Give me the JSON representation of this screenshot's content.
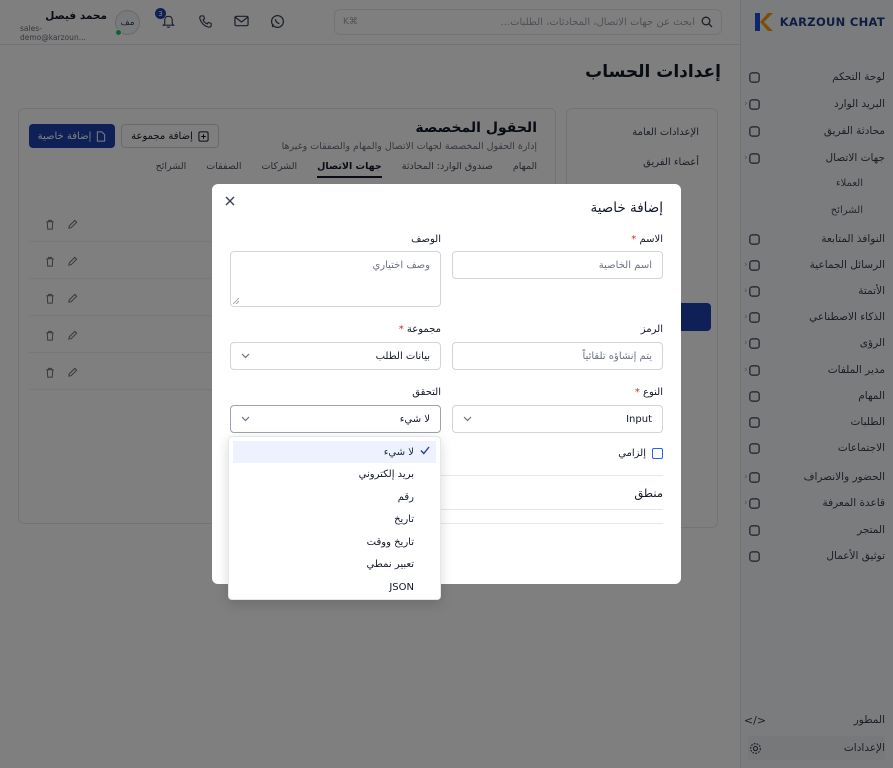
{
  "brand": {
    "name": "KARZOUN CHAT",
    "logo_letter": "K"
  },
  "header": {
    "search_placeholder": "ابحث عن جهات الاتصال، المحادثات، الطلبات...",
    "shortcut": "⌘K",
    "notification_count": "3",
    "user_name": "محمد فيصل",
    "user_email": "sales-demo@karzoun...",
    "avatar_text": "مف"
  },
  "sidebar": {
    "items": [
      {
        "label": "لوحة التحكم",
        "icon": "home-icon"
      },
      {
        "label": "البريد الوارد",
        "icon": "inbox-icon",
        "chevron": true
      },
      {
        "label": "محادثة الفريق",
        "icon": "chat-icon"
      },
      {
        "label": "جهات الاتصال",
        "icon": "users-icon",
        "chevron": true
      },
      {
        "label": "النوافذ المتابعة",
        "icon": "calendar-icon"
      },
      {
        "label": "الرسائل الجماعية",
        "icon": "megaphone-icon",
        "chevron": true
      },
      {
        "label": "الأتمتة",
        "icon": "automation-icon",
        "chevron": true
      },
      {
        "label": "الذكاء الاصطناعي",
        "icon": "sparkle-icon",
        "chevron": true
      },
      {
        "label": "الرؤى",
        "icon": "chart-icon",
        "chevron": true
      },
      {
        "label": "مدير الملفات",
        "icon": "folder-icon",
        "chevron": true
      },
      {
        "label": "المهام",
        "icon": "task-icon"
      },
      {
        "label": "الطلبات",
        "icon": "cart-icon"
      },
      {
        "label": "الاجتماعات",
        "icon": "meeting-icon"
      },
      {
        "label": "الحضور والانصراف",
        "icon": "clock-icon",
        "chevron": true
      },
      {
        "label": "قاعدة المعرفة",
        "icon": "book-icon",
        "chevron": true
      },
      {
        "label": "المتجر",
        "icon": "store-icon"
      },
      {
        "label": "توثيق الأعمال",
        "icon": "shield-check-icon"
      }
    ],
    "sub_items": [
      "العملاء",
      "الشرائح"
    ],
    "developer": "المطور",
    "settings": "الإعدادات"
  },
  "page": {
    "title": "إعدادات الحساب",
    "settings_nav": [
      "الإعدادات العامة",
      "أعضاء الفريق"
    ],
    "section_title": "الحقول المخصصة",
    "section_subtitle": "إدارة الحقول المخصصة لجهات الاتصال والمهام والصفقات وغيرها",
    "add_property_btn": "إضافة خاصية",
    "add_group_btn": "إضافة مجموعة",
    "tabs": [
      "المهام",
      "صندوق الوارد: المحادثة",
      "جهات الاتصال",
      "الشركات",
      "الصفقات",
      "الشرائح"
    ],
    "active_tab_index": 2
  },
  "modal": {
    "title": "إضافة خاصية",
    "name_label": "الاسم",
    "name_placeholder": "اسم الخاصية",
    "desc_label": "الوصف",
    "desc_placeholder": "وصف اختياري",
    "code_label": "الرمز",
    "code_placeholder": "يتم إنشاؤه تلقائياً",
    "group_label": "مجموعة",
    "group_value": "بيانات الطلب",
    "type_label": "النوع",
    "type_value": "Input",
    "validation_label": "التحقق",
    "validation_value": "لا شيء",
    "required_label": "إلزامي",
    "required_checked": false,
    "logic_label": "منطق"
  },
  "validation_options": [
    "لا شيء",
    "بريد إلكتروني",
    "رقم",
    "تاريخ",
    "تاريخ ووقت",
    "تعبير نمطي",
    "JSON"
  ],
  "validation_selected_index": 0,
  "colors": {
    "primary": "#1e40af",
    "brand_blue": "#1d4ed8",
    "brand_orange": "#f59e0b"
  }
}
